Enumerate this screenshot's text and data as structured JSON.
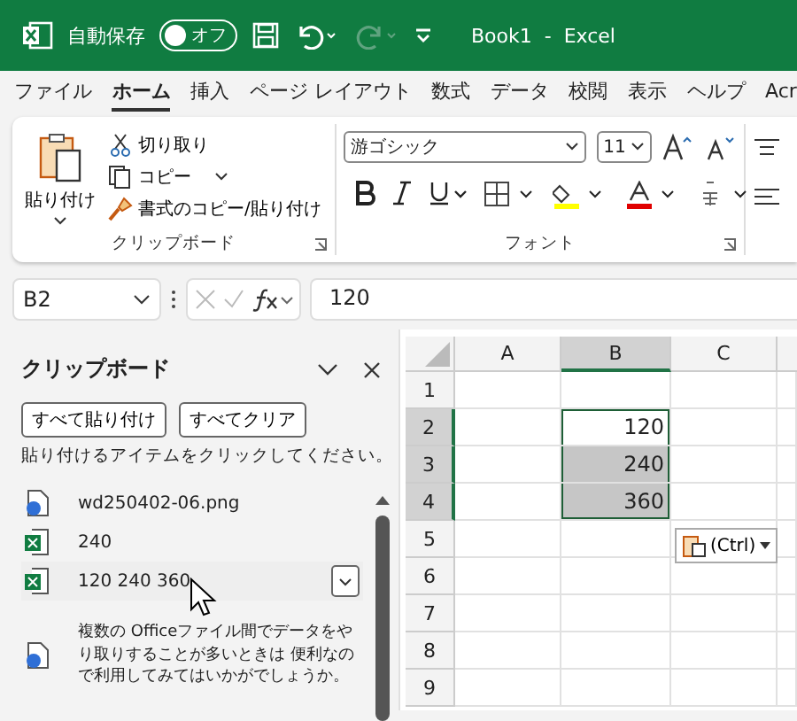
{
  "title_bar": {
    "autosave_label": "自動保存",
    "autosave_toggle": {
      "label": "オフ",
      "on": false
    },
    "title": "Book1  -  Excel"
  },
  "menu": [
    {
      "label": "ファイル",
      "selected": false
    },
    {
      "label": "ホーム",
      "selected": true
    },
    {
      "label": "挿入",
      "selected": false
    },
    {
      "label": "ページ レイアウト",
      "selected": false
    },
    {
      "label": "数式",
      "selected": false
    },
    {
      "label": "データ",
      "selected": false
    },
    {
      "label": "校閲",
      "selected": false
    },
    {
      "label": "表示",
      "selected": false
    },
    {
      "label": "ヘルプ",
      "selected": false
    },
    {
      "label": "Acr",
      "selected": false
    }
  ],
  "ribbon": {
    "clipboard": {
      "paste": "貼り付け",
      "cut": "切り取り",
      "copy": "コピー",
      "format_painter": "書式のコピー/貼り付け",
      "label": "クリップボード"
    },
    "font": {
      "font_name": "游ゴシック",
      "font_size": "11",
      "label": "フォント"
    }
  },
  "formula_bar": {
    "name_box": "B2",
    "value": "120"
  },
  "clipboard_pane": {
    "title": "クリップボード",
    "buttons": [
      "すべて貼り付け",
      "すべてクリア"
    ],
    "hint": "貼り付けるアイテムをクリックしてください。",
    "items": [
      {
        "kind": "image",
        "text": "wd250402-06.png",
        "selected": false
      },
      {
        "kind": "excel",
        "text": "240",
        "selected": false
      },
      {
        "kind": "excel",
        "text": "120 240 360",
        "selected": true
      }
    ],
    "info": "複数の Officeファイル間でデータをやり取りすることが多いときは 便利なので利用してみてはいかがでしょうか。"
  },
  "sheet": {
    "columns": [
      {
        "label": "A",
        "selected": false
      },
      {
        "label": "B",
        "selected": true
      },
      {
        "label": "C",
        "selected": false
      }
    ],
    "rows": [
      {
        "label": "1",
        "selected": false
      },
      {
        "label": "2",
        "selected": true,
        "value": "120"
      },
      {
        "label": "3",
        "selected": true,
        "value": "240"
      },
      {
        "label": "4",
        "selected": true,
        "value": "360"
      },
      {
        "label": "5",
        "selected": false
      },
      {
        "label": "6",
        "selected": false
      },
      {
        "label": "7",
        "selected": false
      },
      {
        "label": "8",
        "selected": false
      },
      {
        "label": "9",
        "selected": false
      }
    ],
    "paste_options": "(Ctrl)"
  }
}
